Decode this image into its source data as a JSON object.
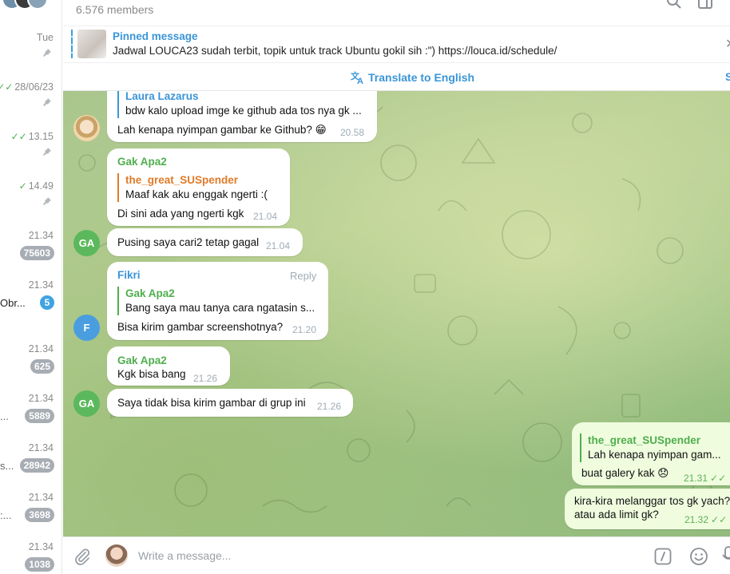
{
  "header": {
    "members": "6.576 members"
  },
  "pinned": {
    "title": "Pinned message",
    "text": "Jadwal LOUCA23 sudah terbit, topik untuk track Ubuntu gokil sih :\")  https://louca.id/schedule/"
  },
  "translate": {
    "label": "Translate to English"
  },
  "chat_list": [
    {
      "time": "Tue",
      "pinned": true
    },
    {
      "time": "28/06/23",
      "check": "✓✓",
      "pinned": true
    },
    {
      "time": "13.15",
      "check": "✓✓",
      "pinned": true
    },
    {
      "time": "14.49",
      "check": "✓",
      "pinned": true
    },
    {
      "time": "21.34",
      "badge": "75603"
    },
    {
      "time": "21.34",
      "snippet": "Obr...",
      "badge": "5"
    },
    {
      "time": "21.34",
      "badge": "625"
    },
    {
      "time": "21.34",
      "snippet": "...",
      "badge": "5889"
    },
    {
      "time": "21.34",
      "snippet": "s...",
      "badge": "28942"
    },
    {
      "time": "21.34",
      "snippet": ":...",
      "badge": "3698"
    },
    {
      "time": "21.34",
      "badge": "1038"
    }
  ],
  "messages": [
    {
      "reply_name": "Laura Lazarus",
      "reply_text": "bdw kalo upload imge ke github ada tos nya gk ...",
      "text": "Lah kenapa nyimpan gambar ke Github? 😁",
      "time": "20.58"
    },
    {
      "sender": "Gak Apa2",
      "reply_name": "the_great_SUSpender",
      "reply_text": "Maaf kak aku enggak ngerti :(",
      "text": "Di sini ada yang ngerti kgk",
      "time": "21.04"
    },
    {
      "avatar": "GA",
      "text": "Pusing saya cari2 tetap gagal",
      "time": "21.04"
    },
    {
      "sender": "Fikri",
      "reply_link": "Reply",
      "reply_name": "Gak Apa2",
      "reply_text": "Bang saya mau tanya cara ngatasin s...",
      "text": "Bisa kirim gambar screenshotnya?",
      "time": "21.20",
      "avatar": "F"
    },
    {
      "sender": "Gak Apa2",
      "text": "Kgk bisa bang",
      "time": "21.26"
    },
    {
      "avatar": "GA",
      "text": "Saya tidak bisa kirim gambar di grup ini",
      "time": "21.26"
    },
    {
      "reply_name": "the_great_SUSpender",
      "reply_text": "Lah kenapa nyimpan gam...",
      "text": "buat galery kak 😞",
      "time": "21.31",
      "status": "✓✓"
    },
    {
      "text_line1": "kira-kira melanggar tos gk yach?",
      "text_line2": "atau ada limit gk?",
      "time": "21.32",
      "status": "✓✓"
    }
  ],
  "composer": {
    "placeholder": "Write a message..."
  },
  "colors": {
    "accent": "#3a95d8",
    "sender_green": "#4fae4e",
    "sender_orange": "#e07b28",
    "avatar_green": "#5cb85c",
    "avatar_blue": "#4a9ee0",
    "out_bubble": "#effdde"
  },
  "icons": [
    "search-icon",
    "panel-icon",
    "close-icon",
    "translate-icon",
    "attach-icon",
    "bot-command-icon",
    "emoji-icon",
    "microphone-icon",
    "pin-icon"
  ]
}
